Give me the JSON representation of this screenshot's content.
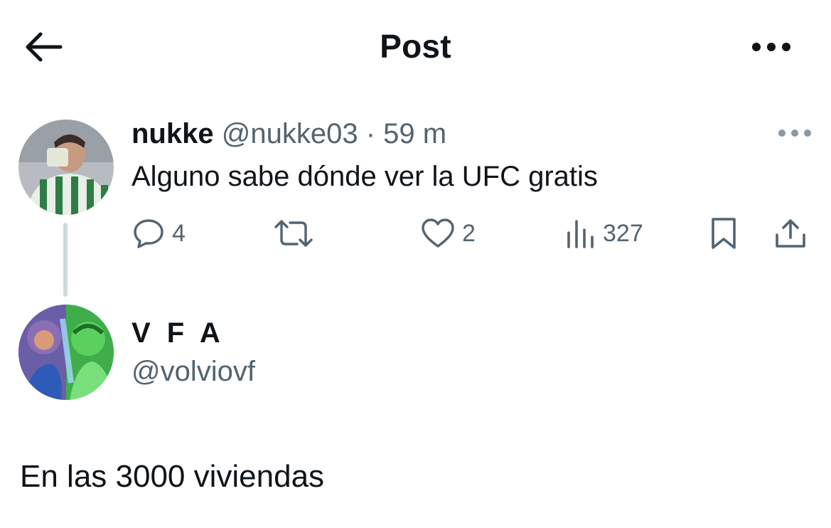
{
  "header": {
    "title": "Post",
    "back_icon": "arrow-left-icon",
    "more_icon": "ellipsis-icon"
  },
  "parent_tweet": {
    "author_name": "nukke",
    "author_handle": "@nukke03",
    "separator": "·",
    "time_ago": "59 m",
    "text": "Alguno sabe dónde ver la UFC gratis",
    "actions": {
      "replies": "4",
      "reposts": "",
      "likes": "2",
      "views": "327"
    }
  },
  "reply": {
    "author_name": "V F A",
    "author_handle": "@volviovf",
    "text": "En las 3000 viviendas"
  },
  "colors": {
    "text_primary": "#0f1419",
    "text_muted": "#536471",
    "thread_line": "#cfd9de",
    "background": "#ffffff"
  }
}
